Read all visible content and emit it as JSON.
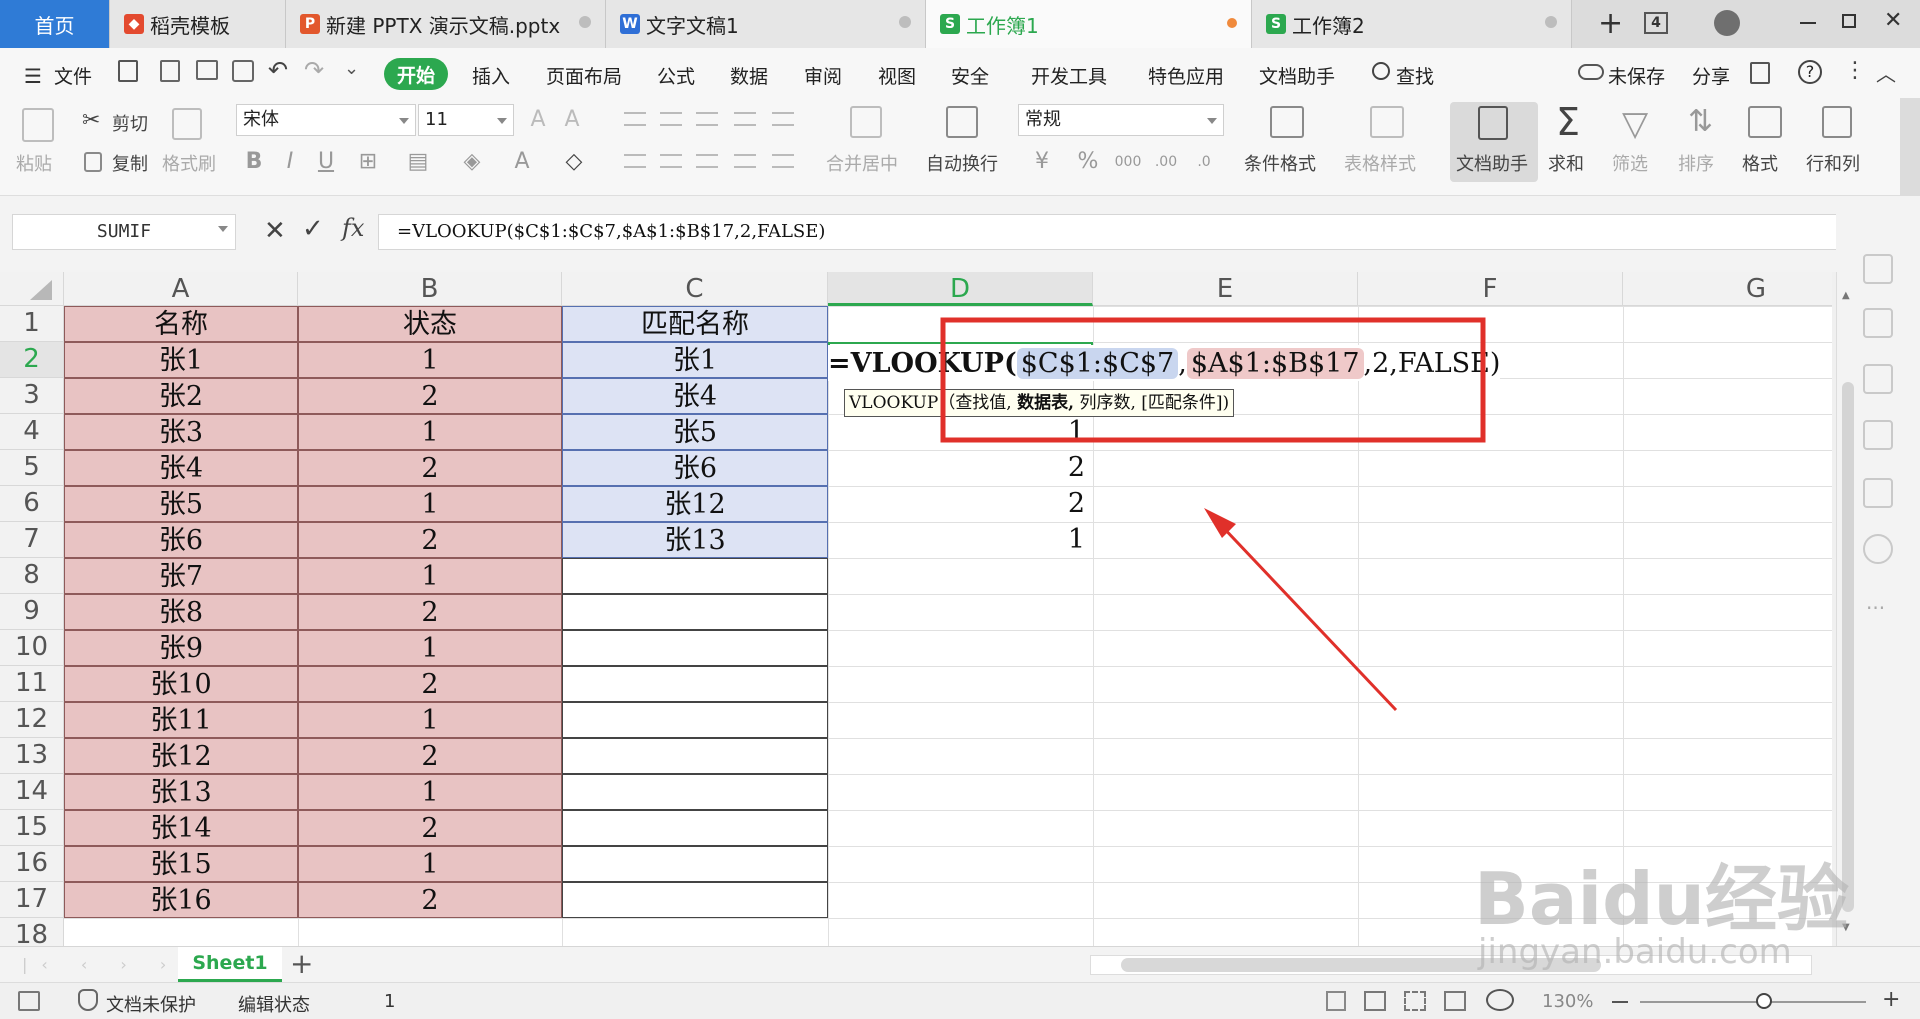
{
  "tabs": [
    {
      "label": "首页"
    },
    {
      "label": "稻壳模板",
      "icon": "daoke-icon"
    },
    {
      "label": "新建 PPTX 演示文稿.pptx",
      "icon": "pptx-icon"
    },
    {
      "label": "文字文稿1",
      "icon": "word-icon"
    },
    {
      "label": "工作簿1",
      "icon": "sheet-icon"
    },
    {
      "label": "工作簿2",
      "icon": "sheet-icon"
    }
  ],
  "tab_count": "4",
  "menu": {
    "file": "文件",
    "items": [
      "开始",
      "插入",
      "页面布局",
      "公式",
      "数据",
      "审阅",
      "视图",
      "安全",
      "开发工具",
      "特色应用",
      "文档助手"
    ],
    "search": "查找",
    "unsaved": "未保存",
    "share": "分享"
  },
  "ribbon": {
    "paste": "粘贴",
    "cut": "剪切",
    "copy": "复制",
    "format_painter": "格式刷",
    "font_name": "宋体",
    "font_size": "11",
    "merge_center": "合并居中",
    "wrap_text": "自动换行",
    "number_format": "常规",
    "cond_format": "条件格式",
    "table_style": "表格样式",
    "doc_assistant": "文档助手",
    "sum": "求和",
    "filter": "筛选",
    "sort": "排序",
    "format": "格式",
    "row_col": "行和列"
  },
  "formula_bar": {
    "name_box": "SUMIF",
    "formula": "=VLOOKUP($C$1:$C$7,$A$1:$B$17,2,FALSE)"
  },
  "columns": [
    "A",
    "B",
    "C",
    "D",
    "E",
    "F",
    "G"
  ],
  "selected_column": "D",
  "selected_row": "2",
  "rows": [
    "1",
    "2",
    "3",
    "4",
    "5",
    "6",
    "7",
    "8",
    "9",
    "10",
    "11",
    "12",
    "13",
    "14",
    "15",
    "16",
    "17",
    "18"
  ],
  "col_a": [
    "名称",
    "张1",
    "张2",
    "张3",
    "张4",
    "张5",
    "张6",
    "张7",
    "张8",
    "张9",
    "张10",
    "张11",
    "张12",
    "张13",
    "张14",
    "张15",
    "张16"
  ],
  "col_b": [
    "状态",
    "1",
    "2",
    "1",
    "2",
    "1",
    "2",
    "1",
    "2",
    "1",
    "2",
    "1",
    "2",
    "1",
    "2",
    "1",
    "2"
  ],
  "col_c": [
    "匹配名称",
    "张1",
    "张4",
    "张5",
    "张6",
    "张12",
    "张13"
  ],
  "col_d": [
    "",
    "",
    "",
    "1",
    "2",
    "2",
    "1"
  ],
  "cell_editor": {
    "prefix": "=VLOOKUP(",
    "arg1": "$C$1:$C$7",
    "sep1": ",",
    "arg2": "$A$1:$B$17",
    "rest": ",2,FALSE)"
  },
  "tooltip": {
    "fn": "VLOOKUP",
    "open": "（",
    "arg1": "查找值,",
    "arg2": "数据表,",
    "arg3": "列序数,",
    "arg4": "[匹配条件]",
    "close": ")"
  },
  "sheet_tab": "Sheet1",
  "status": {
    "protect": "文档未保护",
    "mode": "编辑状态",
    "count": "1",
    "zoom": "130%"
  },
  "watermark": {
    "brand": "Baidu经验",
    "url": "jingyan.baidu.com"
  },
  "colors": {
    "accent_green": "#2ca84f",
    "red_fill": "#e8c3c3",
    "blue_fill": "#dde3f4",
    "annotation_red": "#e0302a"
  }
}
